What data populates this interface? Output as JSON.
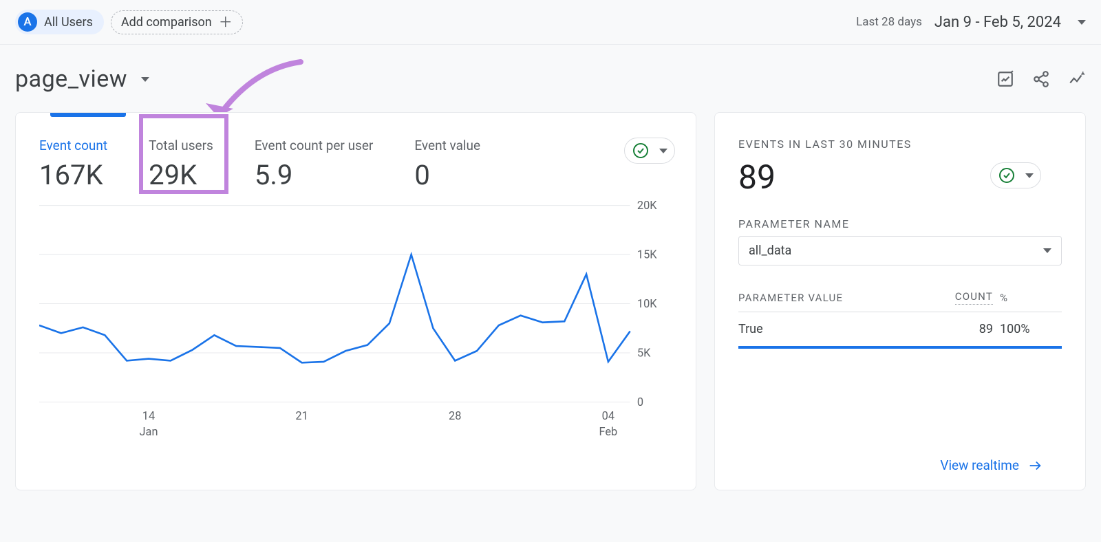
{
  "topbar": {
    "avatar_letter": "A",
    "all_users_label": "All Users",
    "add_comparison_label": "Add comparison",
    "date_preset": "Last 28 days",
    "date_range": "Jan 9 - Feb 5, 2024"
  },
  "title": "page_view",
  "metrics": [
    {
      "label": "Event count",
      "value": "167K",
      "active": true
    },
    {
      "label": "Total users",
      "value": "29K",
      "active": false
    },
    {
      "label": "Event count per user",
      "value": "5.9",
      "active": false
    },
    {
      "label": "Event value",
      "value": "0",
      "active": false
    }
  ],
  "chart_data": {
    "type": "line",
    "title": "",
    "xlabel": "",
    "ylabel": "",
    "ylim": [
      0,
      20000
    ],
    "yticks": [
      0,
      5000,
      10000,
      15000,
      20000
    ],
    "ytick_labels": [
      "0",
      "5K",
      "10K",
      "15K",
      "20K"
    ],
    "xticks": [
      5,
      12,
      19,
      26
    ],
    "xtick_labels": [
      {
        "top": "14",
        "bottom": "Jan"
      },
      {
        "top": "21",
        "bottom": ""
      },
      {
        "top": "28",
        "bottom": ""
      },
      {
        "top": "04",
        "bottom": "Feb"
      }
    ],
    "x": [
      0,
      1,
      2,
      3,
      4,
      5,
      6,
      7,
      8,
      9,
      10,
      11,
      12,
      13,
      14,
      15,
      16,
      17,
      18,
      19,
      20,
      21,
      22,
      23,
      24,
      25,
      26,
      27
    ],
    "series": [
      {
        "name": "Event count",
        "values": [
          7800,
          7000,
          7600,
          6800,
          4200,
          4400,
          4200,
          5300,
          6800,
          5700,
          5600,
          5500,
          4000,
          4100,
          5200,
          5800,
          8000,
          15000,
          7500,
          4200,
          5200,
          7800,
          8800,
          8100,
          8200,
          13000,
          4100,
          7200
        ]
      }
    ]
  },
  "realtime": {
    "title": "EVENTS IN LAST 30 MINUTES",
    "value": "89",
    "param_name_label": "PARAMETER NAME",
    "param_name_value": "all_data",
    "table": {
      "head_value": "PARAMETER VALUE",
      "head_count": "COUNT",
      "head_pct": "%",
      "rows": [
        {
          "value": "True",
          "count": "89",
          "pct": "100%",
          "bar_pct": 100
        }
      ]
    },
    "link_label": "View realtime"
  }
}
